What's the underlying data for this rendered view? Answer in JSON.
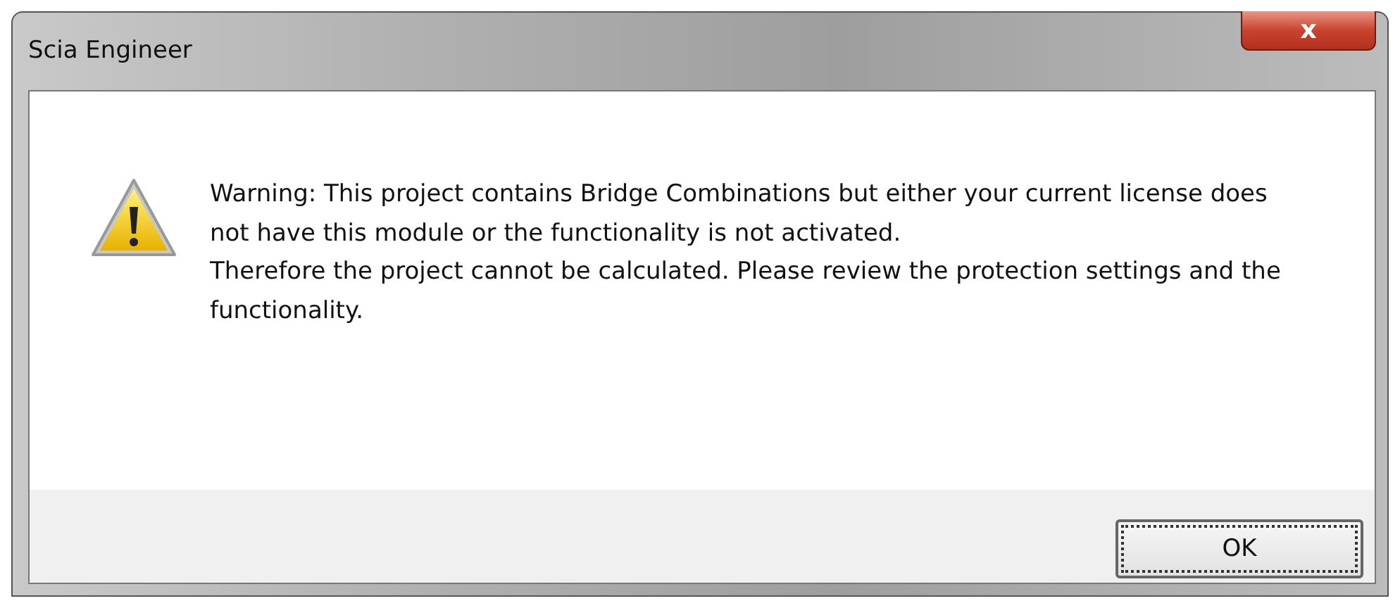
{
  "window": {
    "title": "Scia Engineer",
    "close": "x"
  },
  "message": {
    "kind": "warning",
    "paragraphs": [
      "Warning: This project contains Bridge Combinations but either your current license does not have this module or the functionality is not activated.",
      "Therefore the project cannot be calculated. Please review the protection settings and the functionality."
    ]
  },
  "buttons": [
    {
      "label": "OK",
      "focused": true
    }
  ]
}
